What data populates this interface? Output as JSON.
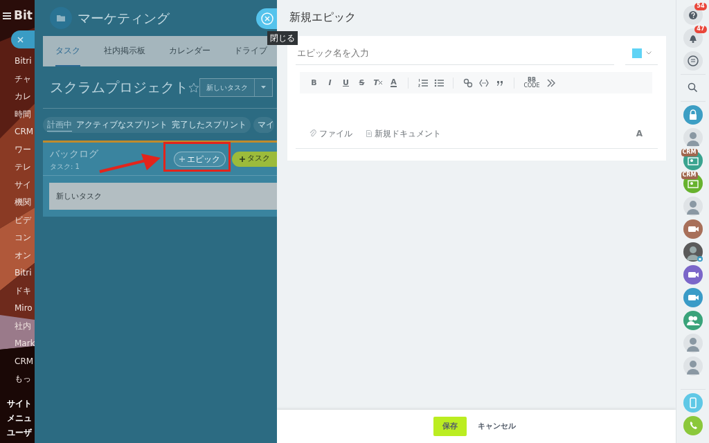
{
  "left_menu": {
    "logo": "Bit",
    "items": [
      "Bitri",
      "チャ",
      "カレ",
      "時間",
      "CRM",
      "ワー",
      "テレ",
      "サイ",
      "機関",
      "ビデ",
      "コン",
      "オン",
      "Bitri",
      "ドキ",
      "Miro",
      "社内",
      "Mark",
      "CRM",
      "もっ"
    ],
    "footer_links": [
      "サイト",
      "メニュ",
      "ユーザ"
    ]
  },
  "project_panel": {
    "title": "マーケティング",
    "close_tooltip": "閉じる",
    "tabs": [
      {
        "label": "タスク",
        "selected": true
      },
      {
        "label": "社内掲示板",
        "selected": false
      },
      {
        "label": "カレンダー",
        "selected": false
      },
      {
        "label": "ドライブ",
        "selected": false
      }
    ],
    "project_title": "スクラムプロジェクト",
    "new_task_button": "新しいタスク",
    "filters": [
      {
        "label": "計画中",
        "selected": true
      },
      {
        "label": "アクティブなスプリント",
        "selected": false
      },
      {
        "label": "完了したスプリント",
        "selected": false
      }
    ],
    "extra_filter": "マイ",
    "backlog": {
      "title": "バックログ",
      "task_count": "タスク: 1",
      "epic_button": "エピック",
      "task_button": "タスク",
      "tasks": [
        {
          "title": "新しいタスク"
        }
      ]
    }
  },
  "epic_form": {
    "title": "新規エピック",
    "name_placeholder": "エピック名を入力",
    "toolbar": [
      {
        "kind": "bold",
        "label": "B"
      },
      {
        "kind": "italic",
        "label": "I"
      },
      {
        "kind": "underline",
        "label": "U"
      },
      {
        "kind": "strike",
        "label": "S"
      },
      {
        "kind": "clear",
        "label": "T"
      },
      {
        "kind": "color",
        "label": "A"
      },
      {
        "kind": "separator"
      },
      {
        "kind": "ordered-list"
      },
      {
        "kind": "bullet-list"
      },
      {
        "kind": "separator"
      },
      {
        "kind": "link"
      },
      {
        "kind": "code"
      },
      {
        "kind": "quote"
      },
      {
        "kind": "separator"
      },
      {
        "kind": "bbcode",
        "label": "BB",
        "sublabel": "CODE"
      },
      {
        "kind": "more"
      }
    ],
    "attachments": [
      {
        "kind": "file",
        "label": "ファイル"
      },
      {
        "kind": "document",
        "label": "新規ドキュメント"
      }
    ],
    "format_toggle": "A",
    "save_button": "保存",
    "cancel_button": "キャンセル"
  },
  "right_bar": [
    {
      "kind": "help",
      "badge": "54"
    },
    {
      "kind": "bell",
      "badge": "47"
    },
    {
      "kind": "chat"
    },
    {
      "kind": "search"
    },
    {
      "kind": "lock"
    },
    {
      "kind": "avatar"
    },
    {
      "kind": "crm",
      "badge": "CRM"
    },
    {
      "kind": "crm2",
      "badge": "CRM"
    },
    {
      "kind": "avatar"
    },
    {
      "kind": "video"
    },
    {
      "kind": "avatar-locked"
    },
    {
      "kind": "video2"
    },
    {
      "kind": "video3"
    },
    {
      "kind": "group"
    },
    {
      "kind": "avatar"
    },
    {
      "kind": "avatar"
    },
    {
      "kind": "cloud-phone"
    },
    {
      "kind": "phone"
    }
  ]
}
